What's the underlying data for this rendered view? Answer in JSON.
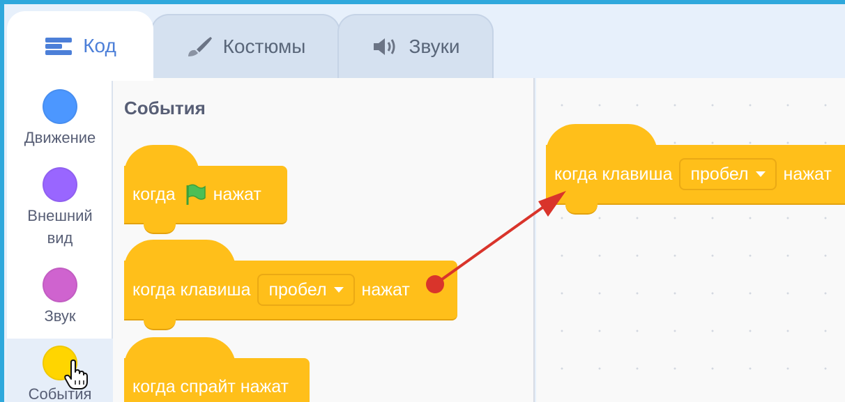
{
  "tabs": [
    {
      "label": "Код",
      "icon": "code-icon"
    },
    {
      "label": "Костюмы",
      "icon": "paintbrush-icon"
    },
    {
      "label": "Звуки",
      "icon": "speaker-icon"
    }
  ],
  "categories": [
    {
      "label": "Движение",
      "color": "#4c97ff"
    },
    {
      "label": "Внешний вид",
      "color": "#9966ff"
    },
    {
      "label": "Звук",
      "color": "#cf63cf"
    },
    {
      "label": "События",
      "color": "#ffd500",
      "selected": true
    }
  ],
  "palette": {
    "title": "События",
    "blocks": [
      {
        "pre": "когда",
        "icon": "green-flag-icon",
        "post": "нажат"
      },
      {
        "pre": "когда клавиша",
        "dropdown": "пробел",
        "post": "нажат"
      },
      {
        "text": "когда спрайт нажат"
      }
    ]
  },
  "workspace": {
    "block": {
      "pre": "когда клавиша",
      "dropdown": "пробел",
      "post": "нажат"
    }
  },
  "colors": {
    "events_block": "#ffbf1a",
    "accent_blue": "#4c7fd8",
    "annotation_arrow": "#d9342b"
  }
}
